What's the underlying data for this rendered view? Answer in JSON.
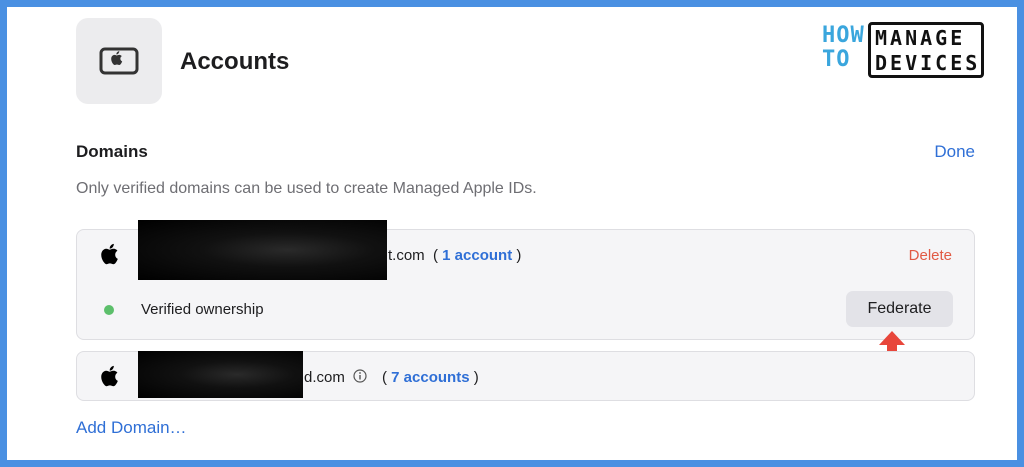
{
  "header": {
    "title": "Accounts",
    "app_icon": "device-tablet-icon"
  },
  "logo": {
    "how": "HOW",
    "to": "TO",
    "manage": "MANAGE",
    "devices": "DEVICES"
  },
  "domains": {
    "heading": "Domains",
    "done_label": "Done",
    "hint": "Only verified domains can be used to create Managed Apple IDs.",
    "items": [
      {
        "domain_visible_suffix": "t.com",
        "accounts_label": "1 account",
        "delete_label": "Delete",
        "status_label": "Verified ownership",
        "federate_label": "Federate"
      },
      {
        "domain_visible_suffix": "d.com",
        "accounts_label": "7 accounts"
      }
    ],
    "add_domain_label": "Add Domain…"
  },
  "colors": {
    "frame": "#4a90e2",
    "link": "#2f6fd6",
    "delete": "#e15a44",
    "verified": "#5cbf6b",
    "arrow": "#e8463b"
  }
}
